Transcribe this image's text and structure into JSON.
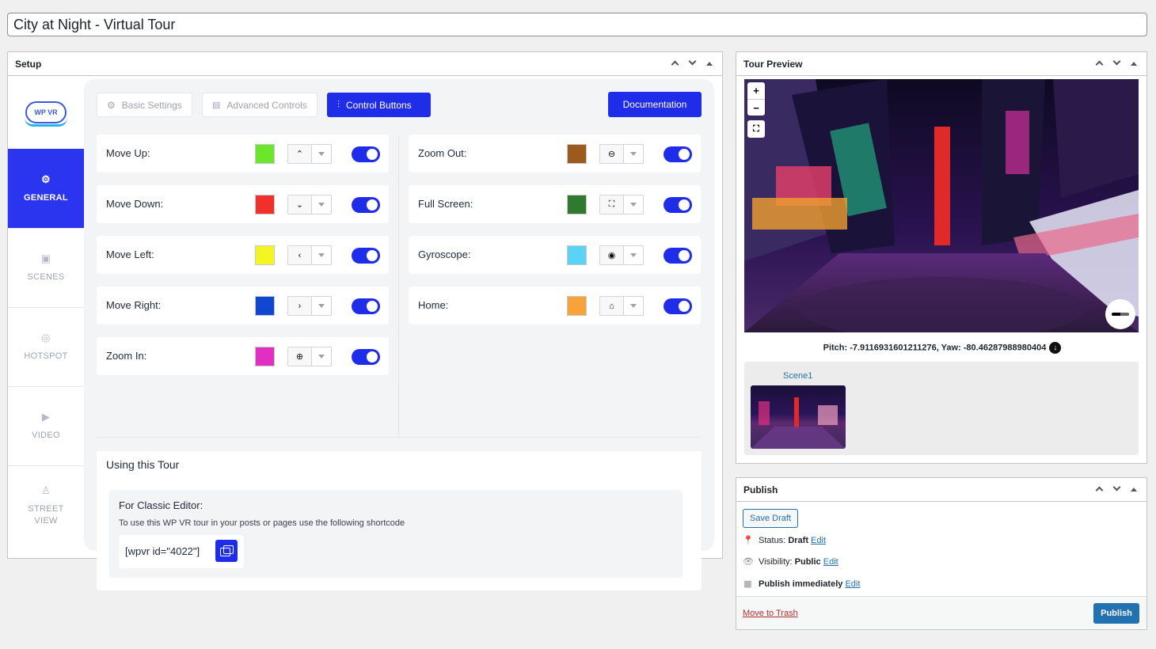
{
  "post_title": "City at Night - Virtual Tour",
  "setup": {
    "title": "Setup",
    "logo_text": "WP VR",
    "sidebar": [
      {
        "label": "GENERAL",
        "icon": "gear-icon"
      },
      {
        "label": "SCENES",
        "icon": "image-icon"
      },
      {
        "label": "HOTSPOT",
        "icon": "hotspot-icon"
      },
      {
        "label": "VIDEO",
        "icon": "video-icon"
      },
      {
        "label": "STREET VIEW",
        "icon": "street-view-icon"
      }
    ],
    "tabs": [
      "Basic Settings",
      "Advanced Controls",
      "Control Buttons"
    ],
    "documentation_label": "Documentation",
    "controls_left": [
      {
        "label": "Move Up:",
        "color": "#6be62b",
        "icon": "chevron-up-icon",
        "glyph": "⌃",
        "enabled": true
      },
      {
        "label": "Move Down:",
        "color": "#f0302b",
        "icon": "chevron-down-icon",
        "glyph": "⌄",
        "enabled": true
      },
      {
        "label": "Move Left:",
        "color": "#f3f623",
        "icon": "chevron-left-icon",
        "glyph": "‹",
        "enabled": true
      },
      {
        "label": "Move Right:",
        "color": "#0f47d1",
        "icon": "chevron-right-icon",
        "glyph": "›",
        "enabled": true
      },
      {
        "label": "Zoom In:",
        "color": "#e12fc2",
        "icon": "plus-circle-icon",
        "glyph": "⊕",
        "enabled": true
      }
    ],
    "controls_right": [
      {
        "label": "Zoom Out:",
        "color": "#9c5b1c",
        "icon": "minus-circle-icon",
        "glyph": "⊖",
        "enabled": true
      },
      {
        "label": "Full Screen:",
        "color": "#2f7a2f",
        "icon": "fullscreen-icon",
        "glyph": "⛶",
        "enabled": true
      },
      {
        "label": "Gyroscope:",
        "color": "#5bd3f5",
        "icon": "gyroscope-icon",
        "glyph": "◉",
        "enabled": true
      },
      {
        "label": "Home:",
        "color": "#f7a23a",
        "icon": "home-icon",
        "glyph": "⌂",
        "enabled": true
      }
    ],
    "using": {
      "title": "Using this Tour",
      "classic_heading": "For Classic Editor:",
      "description": "To use this WP VR tour in your posts or pages use the following shortcode",
      "shortcode": "[wpvr id=\"4022\"]"
    }
  },
  "preview": {
    "title": "Tour Preview",
    "zoom_in": "+",
    "zoom_out": "−",
    "pitch_yaw": "Pitch: -7.9116931601211276, Yaw: -80.46287988980404",
    "scene_label": "Scene1"
  },
  "publish": {
    "title": "Publish",
    "save_draft": "Save Draft",
    "status_label": "Status:",
    "status_value": "Draft",
    "visibility_label": "Visibility:",
    "visibility_value": "Public",
    "schedule_text": "Publish immediately",
    "edit_label": "Edit",
    "trash_label": "Move to Trash",
    "publish_label": "Publish"
  }
}
